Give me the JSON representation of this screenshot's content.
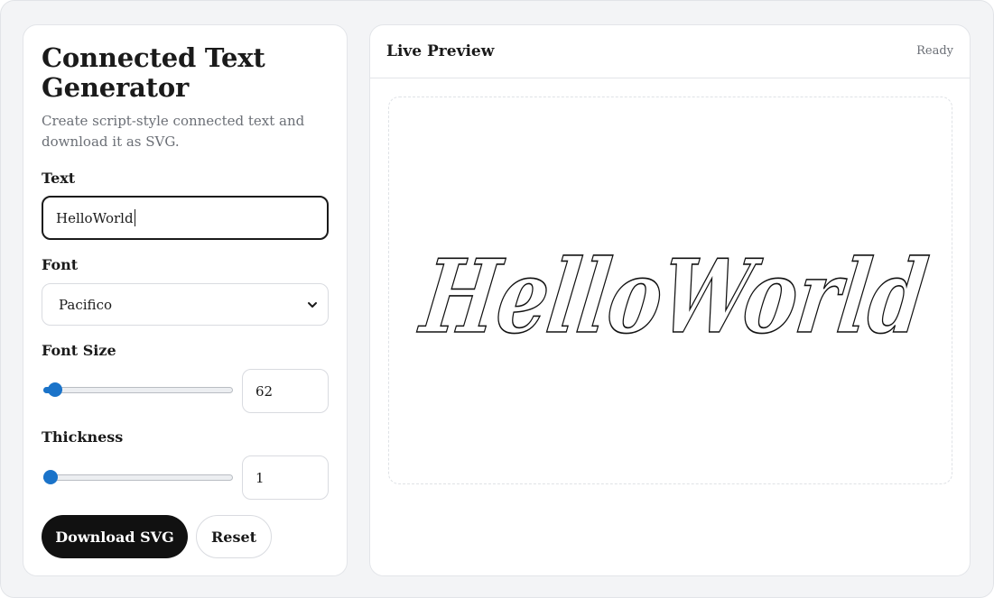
{
  "app": {
    "title": "Connected Text Generator",
    "subtitle": "Create script-style connected text and download it as SVG."
  },
  "controls": {
    "text_label": "Text",
    "text_value": "HelloWorld",
    "font_label": "Font",
    "font_selected": "Pacifico",
    "font_size_label": "Font Size",
    "font_size_value": "62",
    "font_size_fraction": 0.06,
    "thickness_label": "Thickness",
    "thickness_value": "1",
    "thickness_fraction": 0.0,
    "download_label": "Download SVG",
    "reset_label": "Reset"
  },
  "preview": {
    "title": "Live Preview",
    "status": "Ready",
    "rendered_text": "HelloWorld"
  },
  "colors": {
    "accent": "#1a73c9",
    "primary_button": "#111111",
    "outline": "#111111"
  },
  "icons": {
    "select_chevron": "chevron-down-icon"
  }
}
